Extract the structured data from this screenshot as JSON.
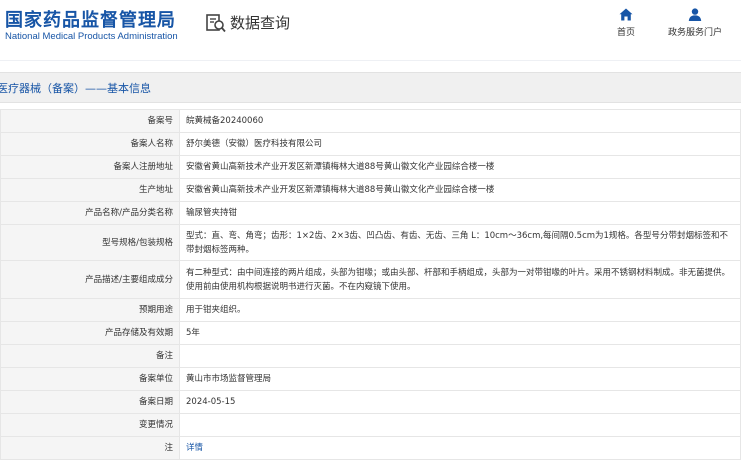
{
  "header": {
    "logo_cn": "国家药品监督管理局",
    "logo_en": "National Medical Products Administration",
    "query_title": "数据查询",
    "nav_home": "首页",
    "nav_portal": "政务服务门户"
  },
  "section": {
    "title": "医疗器械（备案）——基本信息"
  },
  "rows": [
    {
      "label": "备案号",
      "value": "皖黄械备20240060"
    },
    {
      "label": "备案人名称",
      "value": "舒尔美德（安徽）医疗科技有限公司"
    },
    {
      "label": "备案人注册地址",
      "value": "安徽省黄山高新技术产业开发区新潭镇梅林大道88号黄山徽文化产业园综合楼一楼"
    },
    {
      "label": "生产地址",
      "value": "安徽省黄山高新技术产业开发区新潭镇梅林大道88号黄山徽文化产业园综合楼一楼"
    },
    {
      "label": "产品名称/产品分类名称",
      "value": "输尿管夹持钳"
    },
    {
      "label": "型号规格/包装规格",
      "value": "型式：直、弯、角弯；齿形：1×2齿、2×3齿、凹凸齿、有齿、无齿、三角 L：10cm～36cm,每间隔0.5cm为1规格。各型号分带封烟标签和不带封烟标签两种。"
    },
    {
      "label": "产品描述/主要组成成分",
      "value": "有二种型式：由中间连接的两片组成，头部为钳喙；或由头部、杆部和手柄组成，头部为一对带钳喙的叶片。采用不锈钢材料制成。非无菌提供。使用前由使用机构根据说明书进行灭菌。不在内窥镜下使用。"
    },
    {
      "label": "预期用途",
      "value": "用于钳夹组织。"
    },
    {
      "label": "产品存储及有效期",
      "value": "5年"
    },
    {
      "label": "备注",
      "value": ""
    },
    {
      "label": "备案单位",
      "value": "黄山市市场监督管理局"
    },
    {
      "label": "备案日期",
      "value": "2024-05-15"
    },
    {
      "label": "变更情况",
      "value": ""
    },
    {
      "label": "注",
      "value": "详情"
    }
  ]
}
